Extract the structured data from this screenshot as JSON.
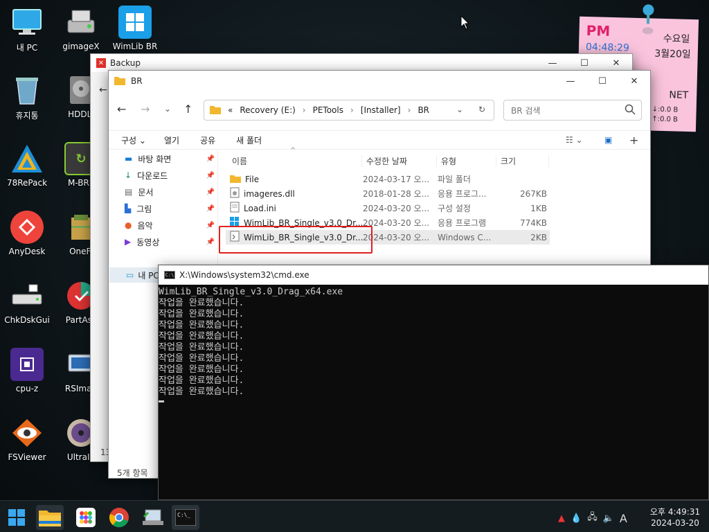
{
  "desktop": {
    "icons": [
      {
        "label": "내 PC",
        "icon": "monitor-icon"
      },
      {
        "label": "gimageX",
        "icon": "drive-icon"
      },
      {
        "label": "WimLib BR",
        "icon": "windows-logo-icon"
      },
      {
        "label": "휴지통",
        "icon": "recycle-bin-icon"
      },
      {
        "label": "HDDLI",
        "icon": "disk-icon"
      },
      {
        "label": "78RePack",
        "icon": "triangle-logo-icon"
      },
      {
        "label": "M-BRP",
        "icon": "mbr-icon"
      },
      {
        "label": "AnyDesk",
        "icon": "anydesk-icon"
      },
      {
        "label": "OneFi",
        "icon": "onefile-icon"
      },
      {
        "label": "ChkDskGui",
        "icon": "chkdsk-icon"
      },
      {
        "label": "PartAss",
        "icon": "partition-icon"
      },
      {
        "label": "cpu-z",
        "icon": "cpu-icon"
      },
      {
        "label": "RSImag",
        "icon": "rsimage-icon"
      },
      {
        "label": "FSViewer",
        "icon": "eye-icon"
      },
      {
        "label": "UltraIS",
        "icon": "cd-icon"
      }
    ]
  },
  "sticky": {
    "ampm": "PM",
    "time": "04:48:29",
    "weekday": "수요일",
    "date": "3월20일",
    "net_label": "NET",
    "down": "↓:0.0 B",
    "up": "↑:0.0 B"
  },
  "backup_window": {
    "title": "Backup",
    "peek_count": "13"
  },
  "explorer": {
    "title": "BR",
    "breadcrumb": {
      "prefix": "«",
      "parts": [
        "Recovery (E:)",
        "PETools",
        "[Installer]",
        "BR"
      ]
    },
    "search_placeholder": "BR 검색",
    "toolbar": {
      "organize": "구성",
      "open": "열기",
      "share": "공유",
      "new_folder": "새 폴더"
    },
    "nav_items": [
      {
        "label": "바탕 화면",
        "icon": "desktop-icon"
      },
      {
        "label": "다운로드",
        "icon": "download-icon"
      },
      {
        "label": "문서",
        "icon": "document-icon"
      },
      {
        "label": "그림",
        "icon": "picture-icon"
      },
      {
        "label": "음악",
        "icon": "music-icon"
      },
      {
        "label": "동영상",
        "icon": "video-icon"
      }
    ],
    "this_pc": "내 PC",
    "columns": [
      "이름",
      "수정한 날짜",
      "유형",
      "크기"
    ],
    "files": [
      {
        "name": "File",
        "date": "2024-03-17 오...",
        "type": "파일 폴더",
        "size": "",
        "icon": "folder-icon"
      },
      {
        "name": "imageres.dll",
        "date": "2018-01-28 오...",
        "type": "응용 프로그...",
        "size": "267KB",
        "icon": "dll-icon"
      },
      {
        "name": "Load.ini",
        "date": "2024-03-20 오...",
        "type": "구성 설정",
        "size": "1KB",
        "icon": "ini-icon"
      },
      {
        "name": "WimLib_BR_Single_v3.0_Dr...",
        "date": "2024-03-20 오...",
        "type": "응용 프로그램",
        "size": "774KB",
        "icon": "exe-icon"
      },
      {
        "name": "WimLib_BR_Single_v3.0_Dr...",
        "date": "2024-03-20 오...",
        "type": "Windows C...",
        "size": "2KB",
        "icon": "cmd-file-icon"
      }
    ],
    "status": "5개 항목"
  },
  "cmd": {
    "title": "X:\\Windows\\system32\\cmd.exe",
    "lines": [
      "WimLib_BR_Single_v3.0_Drag_x64.exe",
      "작업을 완료했습니다.",
      "작업을 완료했습니다.",
      "작업을 완료했습니다.",
      "작업을 완료했습니다.",
      "작업을 완료했습니다.",
      "작업을 완료했습니다.",
      "작업을 완료했습니다.",
      "작업을 완료했습니다.",
      "작업을 완료했습니다."
    ]
  },
  "taskbar": {
    "time": "오후 4:49:31",
    "date": "2024-03-20",
    "ime": "A"
  }
}
